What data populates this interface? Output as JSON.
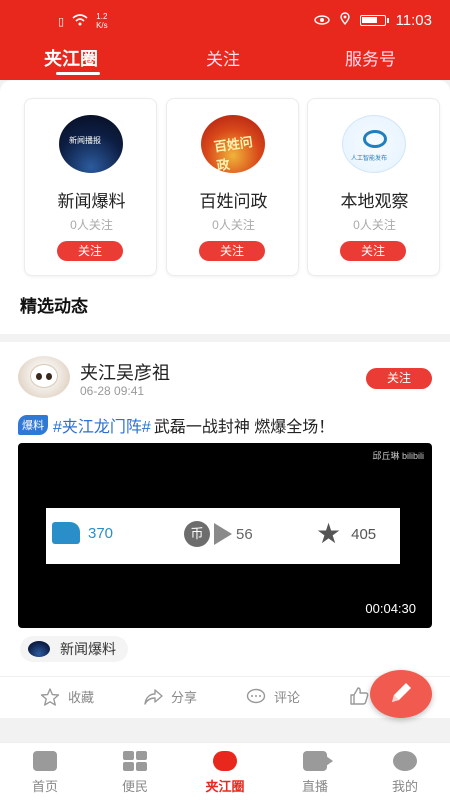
{
  "status_bar": {
    "speed_value": "1.2",
    "speed_unit": "K/s",
    "time": "11:03",
    "battery_level": 0.7
  },
  "top_tabs": [
    {
      "label": "夹江圈",
      "active": true
    },
    {
      "label": "关注",
      "active": false
    },
    {
      "label": "服务号",
      "active": false
    }
  ],
  "topics": [
    {
      "avatar_text": "新闻播报",
      "name": "新闻爆料",
      "followers": "0人关注",
      "follow_label": "关注"
    },
    {
      "avatar_text": "百姓问政",
      "name": "百姓问政",
      "followers": "0人关注",
      "follow_label": "关注"
    },
    {
      "avatar_text": "人工智能发布",
      "name": "本地观察",
      "followers": "0人关注",
      "follow_label": "关注"
    }
  ],
  "section_title": "精选动态",
  "post": {
    "author": "夹江吴彦祖",
    "time": "06-28 09:41",
    "follow_label": "关注",
    "tag": "爆料",
    "hashtag": "#夹江龙门阵#",
    "text": "武磊一战封神  燃爆全场！",
    "video": {
      "watermark": "邱丘琳 bilibili",
      "like_count": "370",
      "coin_label": "币",
      "coin_count": "56",
      "star_count": "405",
      "duration": "00:04:30"
    },
    "source": "新闻爆料",
    "actions": {
      "collect": "收藏",
      "share": "分享",
      "comment": "评论"
    }
  },
  "bottom_nav": [
    {
      "label": "首页",
      "icon": "home-icon",
      "active": false
    },
    {
      "label": "便民",
      "icon": "grid-icon",
      "active": false
    },
    {
      "label": "夹江圈",
      "icon": "circle-icon",
      "active": true
    },
    {
      "label": "直播",
      "icon": "live-icon",
      "active": false
    },
    {
      "label": "我的",
      "icon": "profile-icon",
      "active": false
    }
  ],
  "colors": {
    "brand_red": "#e8271d",
    "follow_red": "#ea3b35",
    "hashtag_blue": "#2e6fd0",
    "tag_blue": "#2e79d6"
  }
}
